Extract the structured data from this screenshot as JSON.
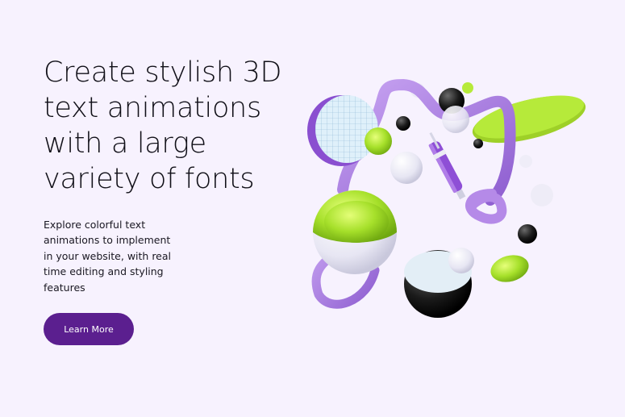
{
  "hero": {
    "title": "Create stylish 3D text animations with a large variety of fonts",
    "subtitle": "Explore colorful text animations to implement in your website, with real time editing and styling features",
    "cta_label": "Learn More"
  },
  "colors": {
    "background": "#f7f2fe",
    "accent_purple": "#5b1f8f",
    "lime": "#a6e02a",
    "lavender": "#a57ad9"
  },
  "illustration": {
    "icon_name": "3d-shapes-illustration"
  }
}
